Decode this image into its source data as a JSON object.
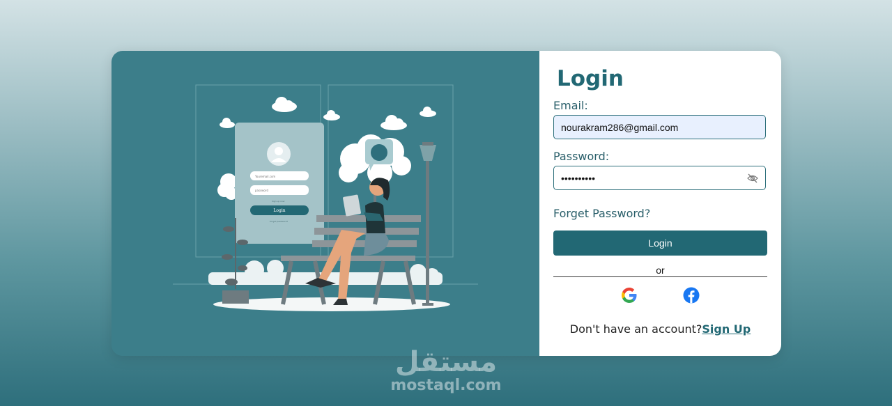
{
  "login": {
    "title": "Login",
    "email_label": "Email:",
    "email_value": "nourakram286@gmail.com",
    "password_label": "Password:",
    "password_value": "••••••••••",
    "forget_password": "Forget Password?",
    "login_button": "Login",
    "or_text": "or",
    "no_account_text": "Don't have an account?",
    "signup_link": "Sign Up"
  },
  "illustration": {
    "mini_form": {
      "email_placeholder": "Youremail.com",
      "password_placeholder": "password",
      "signup_text": "Sign up now",
      "login_button": "Login",
      "forgot_text": "Forgot password?"
    }
  },
  "social": {
    "icons": [
      "google-icon",
      "facebook-icon"
    ]
  },
  "watermark": {
    "arabic": "مستقل",
    "latin": "mostaql.com"
  },
  "colors": {
    "accent": "#226874",
    "panel": "#3c7e8a",
    "email_fill": "#e8f0fe"
  }
}
